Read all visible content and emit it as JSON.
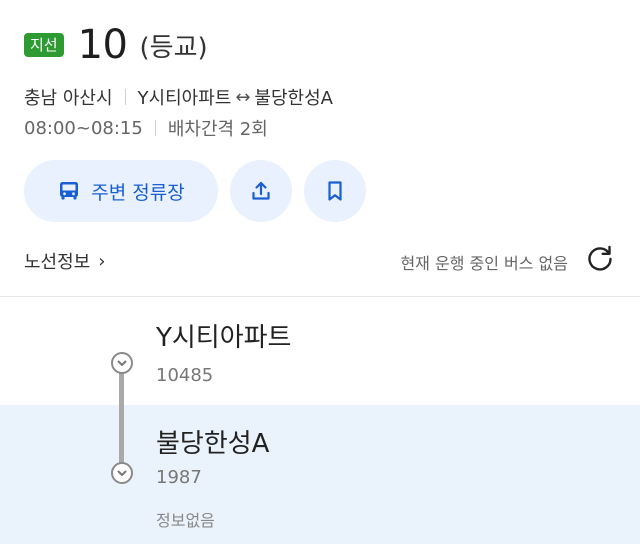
{
  "header": {
    "badge": "지선",
    "route_number": "10",
    "route_subtitle": "(등교)"
  },
  "info": {
    "region": "충남 아산시",
    "origin": "Y시티아파트",
    "arrow": "↔",
    "destination": "불당한성A",
    "hours": "08:00~08:15",
    "interval": "배차간격 2회"
  },
  "actions": {
    "nearby_label": "주변 정류장",
    "icons": [
      "bus-icon",
      "share-icon",
      "bookmark-icon"
    ]
  },
  "route_info": {
    "label": "노선정보",
    "chevron": "›",
    "status": "현재 운행 중인 버스 없음"
  },
  "stops": [
    {
      "name": "Y시티아파트",
      "id": "10485"
    },
    {
      "name": "불당한성A",
      "id": "1987",
      "note": "정보없음"
    }
  ],
  "colors": {
    "badge": "#2e9a32",
    "accent": "#1a5fd1",
    "pill_bg": "#e8f1fd",
    "highlight_row": "#eaf2fb"
  }
}
